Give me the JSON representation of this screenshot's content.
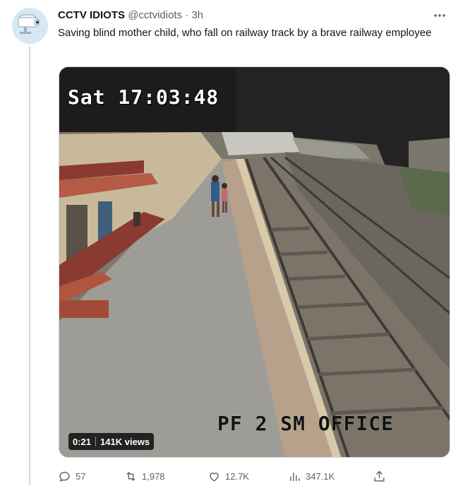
{
  "tweet": {
    "display_name": "CCTV IDIOTS",
    "handle": "@cctvidiots",
    "separator": "·",
    "time": "3h",
    "text": "Saving blind mother child, who fall on railway track by a brave railway employee",
    "avatar_icon": "cctv-camera-icon",
    "more_icon": "more-options-icon"
  },
  "media": {
    "overlay_top": "Sat 17:03:48",
    "overlay_bottom": "PF 2 SM OFFICE",
    "duration": "0:21",
    "views": "141K views"
  },
  "actions": {
    "reply_count": "57",
    "retweet_count": "1,978",
    "like_count": "12.7K",
    "analytics_count": "347.1K",
    "share_icon": "share-icon"
  },
  "colors": {
    "text_primary": "#0f1419",
    "text_secondary": "#536471",
    "border": "#cfd9de"
  }
}
